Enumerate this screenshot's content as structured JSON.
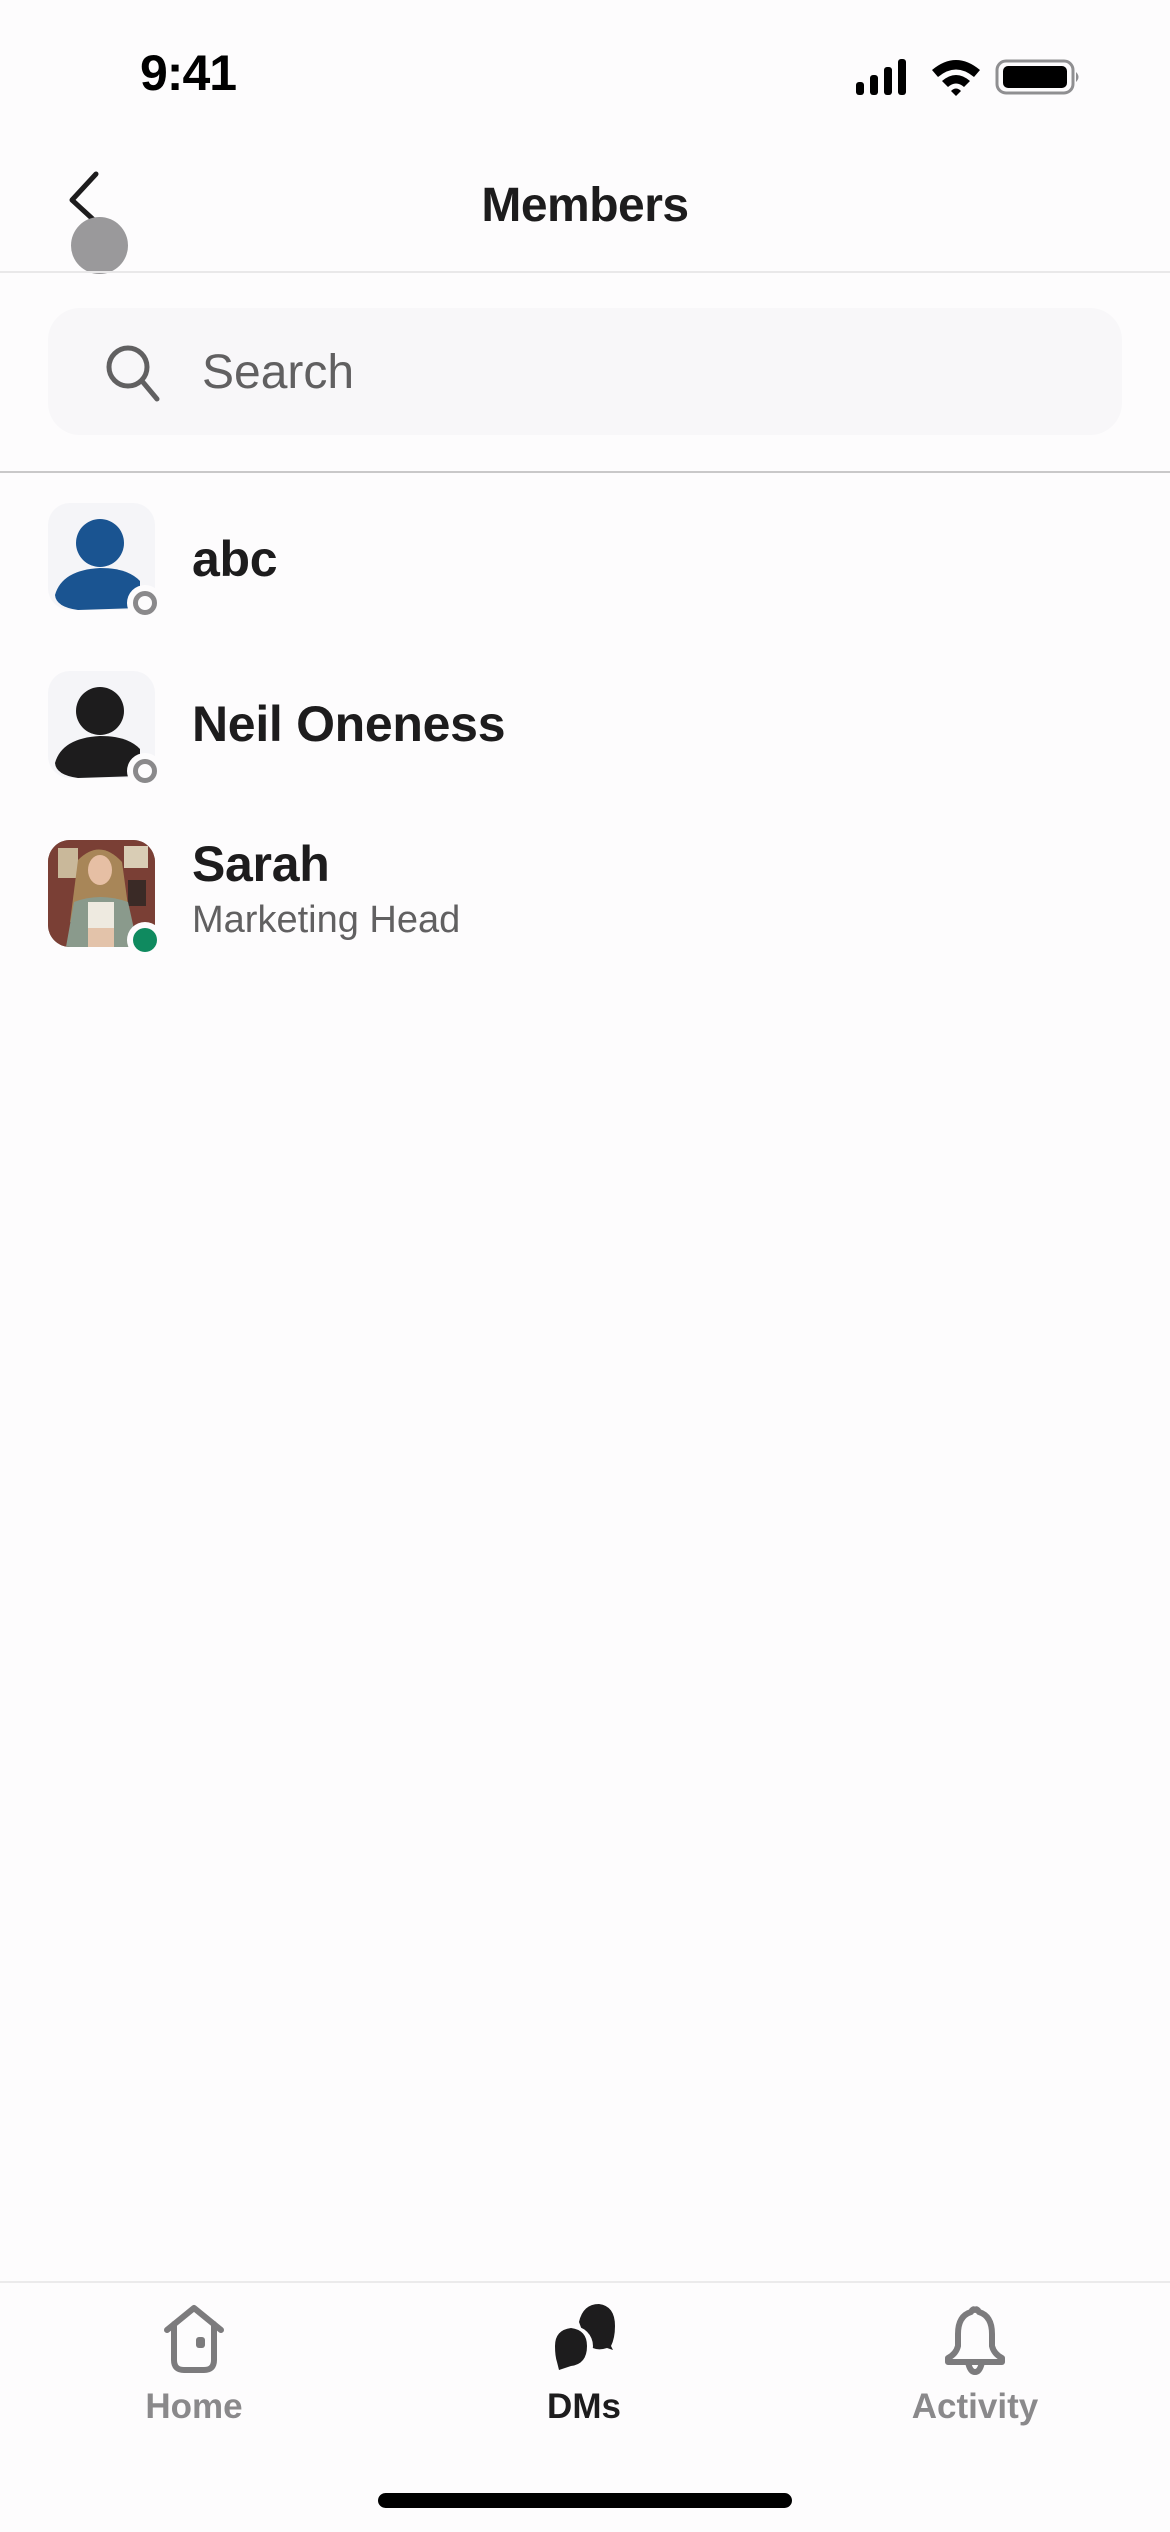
{
  "status_bar": {
    "time": "9:41",
    "icons": [
      "cellular-signal-icon",
      "wifi-icon",
      "battery-icon"
    ]
  },
  "header": {
    "title": "Members",
    "back_icon": "chevron-left-icon"
  },
  "search": {
    "placeholder": "Search",
    "value": "",
    "icon": "search-icon"
  },
  "members": [
    {
      "name": "abc",
      "subtitle": "",
      "avatar": "default-person",
      "avatar_color": "#1a5491",
      "presence": "away"
    },
    {
      "name": "Neil Oneness",
      "subtitle": "",
      "avatar": "default-person",
      "avatar_color": "#1d1c1d",
      "presence": "away"
    },
    {
      "name": "Sarah",
      "subtitle": "Marketing Head",
      "avatar": "photo",
      "presence": "active"
    }
  ],
  "tab_bar": {
    "tabs": [
      {
        "label": "Home",
        "icon": "home-icon",
        "active": false
      },
      {
        "label": "DMs",
        "icon": "chat-bubbles-icon",
        "active": true
      },
      {
        "label": "Activity",
        "icon": "bell-icon",
        "active": false
      }
    ]
  },
  "colors": {
    "presence_active": "#0f8a5f",
    "presence_away": "#8a898b",
    "text_primary": "#1d1c1d",
    "text_secondary": "#616061"
  }
}
